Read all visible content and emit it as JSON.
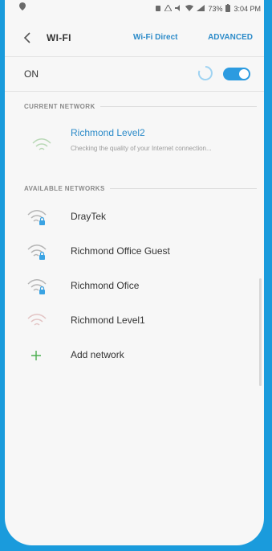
{
  "status_bar": {
    "time": "3:04 PM",
    "battery": "73%"
  },
  "header": {
    "title": "WI-FI",
    "wifi_direct_label": "Wi-Fi Direct",
    "advanced_label": "ADVANCED"
  },
  "wifi_toggle": {
    "label": "ON",
    "state": true,
    "accent": "#2c9be0"
  },
  "current_network": {
    "section_label": "CURRENT NETWORK",
    "name": "Richmond Level2",
    "status": "Checking the quality of your Internet connection..."
  },
  "available_networks": {
    "section_label": "AVAILABLE NETWORKS",
    "items": [
      {
        "name": "DrayTek",
        "secured": true
      },
      {
        "name": "Richmond Office Guest",
        "secured": true
      },
      {
        "name": "Richmond Ofice",
        "secured": true
      },
      {
        "name": "Richmond Level1",
        "secured": false
      }
    ],
    "add_label": "Add network"
  },
  "colors": {
    "accent_blue": "#2c8bc9",
    "wifi_icon": "#b5b5b5",
    "lock_icon": "#3aa3e3",
    "add_icon": "#4caf50",
    "frame_blue": "#1a9bdc"
  }
}
